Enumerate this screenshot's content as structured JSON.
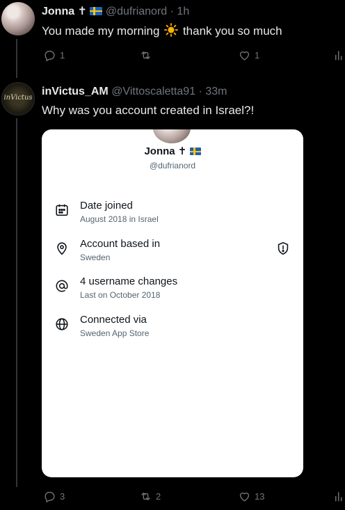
{
  "tweets": [
    {
      "name": "Jonna",
      "name_symbol": "✝",
      "handle": "@dufrianord",
      "time": "· 1h",
      "text_before": "You made my morning",
      "text_after": "thank you so much",
      "actions": {
        "replies": "1",
        "retweets": "",
        "likes": "1"
      },
      "icons": [
        "reply-icon",
        "retweet-icon",
        "like-icon",
        "views-icon"
      ]
    },
    {
      "name": "inVictus_AM",
      "avatar_text": "inVictus",
      "handle": "@Vittoscaletta91",
      "time": "· 33m",
      "text": "Why was you account created in Israel?!",
      "actions": {
        "replies": "3",
        "retweets": "2",
        "likes": "13"
      }
    }
  ],
  "card": {
    "name": "Jonna",
    "name_symbol": "✝",
    "handle": "@dufrianord",
    "rows": [
      {
        "label": "Date joined",
        "value": "August 2018 in Israel",
        "icon": "calendar-icon"
      },
      {
        "label": "Account based in",
        "value": "Sweden",
        "icon": "location-pin-icon",
        "badge": "shield-alert-icon"
      },
      {
        "label": "4 username changes",
        "value": "Last on October 2018",
        "icon": "at-sign-icon"
      },
      {
        "label": "Connected via",
        "value": "Sweden App Store",
        "icon": "globe-icon"
      }
    ]
  },
  "colors": {
    "background": "#000000",
    "text": "#e7e9ea",
    "muted": "#71767b",
    "card_bg": "#ffffff",
    "card_sub": "#536471",
    "sun": "#ffb300",
    "flag_blue": "#1f5fb8",
    "flag_yellow": "#f5c518"
  }
}
